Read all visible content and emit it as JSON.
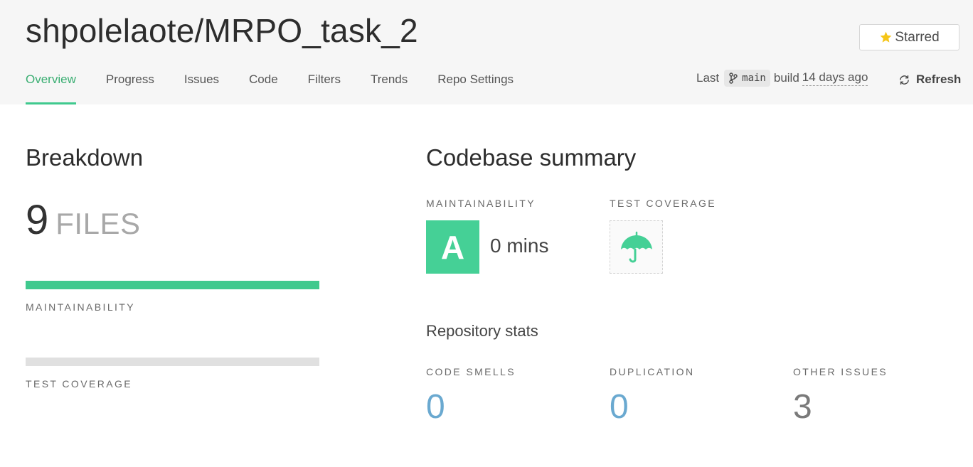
{
  "header": {
    "repo_title": "shpolelaote/MRPO_task_2",
    "star_label": "Starred",
    "tabs": [
      {
        "label": "Overview",
        "active": true
      },
      {
        "label": "Progress",
        "active": false
      },
      {
        "label": "Issues",
        "active": false
      },
      {
        "label": "Code",
        "active": false
      },
      {
        "label": "Filters",
        "active": false
      },
      {
        "label": "Trends",
        "active": false
      },
      {
        "label": "Repo Settings",
        "active": false
      }
    ],
    "build": {
      "prefix": "Last",
      "branch": "main",
      "middle": "build",
      "time_ago": "14 days ago"
    },
    "refresh_label": "Refresh"
  },
  "breakdown": {
    "title": "Breakdown",
    "files_count": "9",
    "files_word": "FILES",
    "maintainability_label": "MAINTAINABILITY",
    "maintainability_fill": 1.0,
    "test_coverage_label": "TEST COVERAGE",
    "test_coverage_fill": 0
  },
  "summary": {
    "title": "Codebase summary",
    "maintainability_label": "MAINTAINABILITY",
    "grade": "A",
    "debt": "0 mins",
    "test_coverage_label": "TEST COVERAGE",
    "coverage_icon": "umbrella-icon"
  },
  "repo_stats": {
    "title": "Repository stats",
    "code_smells_label": "CODE SMELLS",
    "code_smells": "0",
    "duplication_label": "DUPLICATION",
    "duplication": "0",
    "other_issues_label": "OTHER ISSUES",
    "other_issues": "3"
  },
  "colors": {
    "accent_green": "#3fc98e",
    "grade_green": "#45d096",
    "stat_blue": "#6aa9d0",
    "stat_gray": "#7a7a7a",
    "bar_empty": "#e0e0e0",
    "star_yellow": "#f5c518"
  }
}
